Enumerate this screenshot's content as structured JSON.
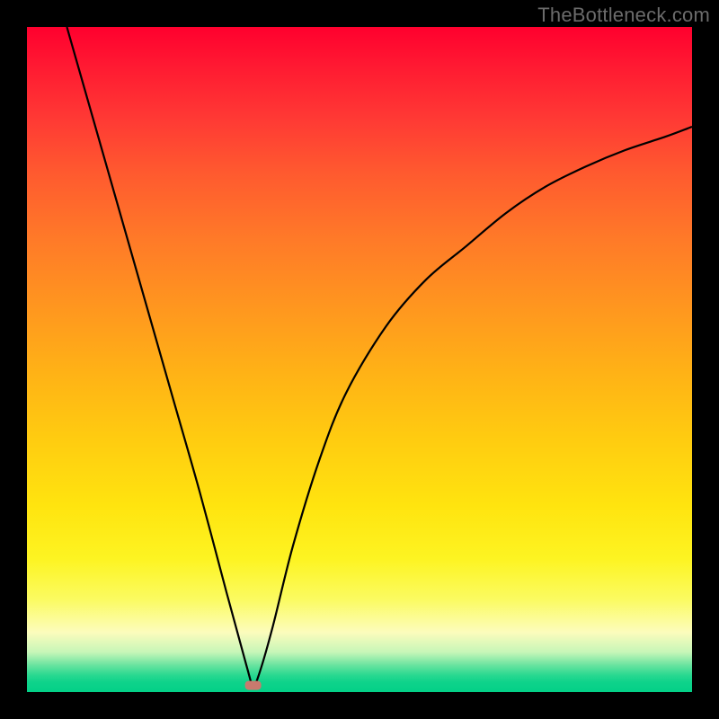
{
  "watermark": "TheBottleneck.com",
  "colors": {
    "frame": "#000000",
    "curve": "#000000",
    "marker": "#c97a6e",
    "gradient_top": "#ff002e",
    "gradient_bottom": "#03d087"
  },
  "chart_data": {
    "type": "line",
    "title": "",
    "xlabel": "",
    "ylabel": "",
    "xlim": [
      0,
      100
    ],
    "ylim": [
      0,
      100
    ],
    "grid": false,
    "legend": false,
    "annotations": [],
    "marker": {
      "x": 34,
      "y": 1,
      "shape": "rounded-rect",
      "color": "#c97a6e"
    },
    "series": [
      {
        "name": "bottleneck-curve",
        "x": [
          6,
          10,
          14,
          18,
          22,
          26,
          30,
          33,
          34,
          35,
          37,
          40,
          44,
          48,
          54,
          60,
          66,
          72,
          78,
          84,
          90,
          96,
          100
        ],
        "y": [
          100,
          86,
          72,
          58,
          44,
          30,
          15,
          4,
          1,
          3,
          10,
          22,
          35,
          45,
          55,
          62,
          67,
          72,
          76,
          79,
          81.5,
          83.5,
          85
        ]
      }
    ]
  }
}
